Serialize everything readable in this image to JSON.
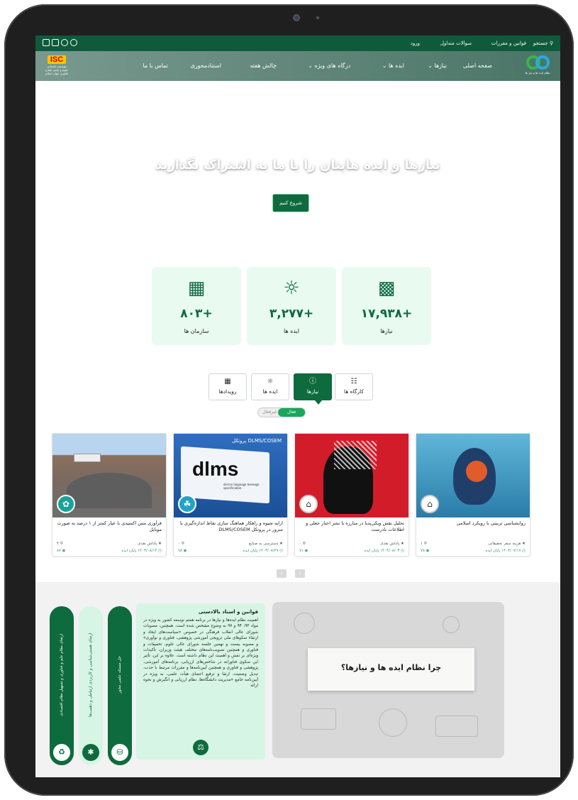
{
  "topbar": {
    "search": "جستجو",
    "rules": "قوانین و مقررات",
    "faq": "سوالات متداول",
    "login": "ورود"
  },
  "logo": {
    "caption": "نظام ایده ها و نیاز ها"
  },
  "isc": {
    "mark": "ISC",
    "caption": "مؤسسه استنادی علوم و پایش علم و فناوری جهان اسلام"
  },
  "nav": {
    "items": [
      "صفحه اصلی",
      "نیازها",
      "ایده ها",
      "درگاه های ویژه",
      "چالش هفته",
      "استنادمحوری",
      "تماس با ما"
    ]
  },
  "hero": {
    "title": "نیازها و ایده هایتان را با ما به اشتراک بگذارید",
    "cta": "شروع کنیم"
  },
  "stats": [
    {
      "value": "+۱۷,۹۳۸",
      "label": "نیازها",
      "icon": "puzzle-icon"
    },
    {
      "value": "+۳,۲۷۷",
      "label": "ایده ها",
      "icon": "lightbulb-icon"
    },
    {
      "value": "+۸۰۳",
      "label": "سازمان ها",
      "icon": "building-icon"
    }
  ],
  "tabs": [
    {
      "label": "کارگاه ها",
      "icon": "workshop-icon"
    },
    {
      "label": "نیازها",
      "icon": "question-icon"
    },
    {
      "label": "ایده ها",
      "icon": "bulb-icon"
    },
    {
      "label": "رویدادها",
      "icon": "calendar-icon"
    }
  ],
  "toggle": {
    "on": "فعال",
    "off": "غیرفعال"
  },
  "cards": [
    {
      "title": "روانشناسی تربیتی با رویکرد اسلامی",
      "reward": "هزینه سفر تحقیقاتی",
      "deadline": "۱۴۰۳/۰۷/۱۷ پایان ایده",
      "count1": "۱",
      "count2": "۷۸"
    },
    {
      "title": "تحلیل نقش ویکی‌پدیا در مبارزه با نشر اخبار جعلی و اطلاعات نادرست",
      "reward": "پاداش نقدی",
      "deadline": "۱۴۰۳/۰۸/۰۳ پایان ایده",
      "count1": "۰",
      "count2": "۷۱"
    },
    {
      "title": "ارایه شیوه و راهکار هماهنگ سازی نقاط اندازه‌گیری با سرور در پروتکل DLMS/COSEM",
      "reward": "دسترسی به صنایع",
      "deadline": "۱۴۰۳/۰۷/۲۹ پایان ایده",
      "count1": "۰",
      "count2": "۹۸",
      "image_banner": "پروتکل DLMS/COSEM",
      "image_word": "dlms",
      "image_sub": "device language message specification"
    },
    {
      "title": "فرآوری مس اکسیدی با عیار کمتر از ۱ درصد به صورت موبایل",
      "reward": "پاداش نقدی",
      "deadline": "۱۴۰۳/۰۸/۱۴ پایان ایده",
      "count1": "۴",
      "count2": "۸۷"
    }
  ],
  "why": {
    "title": "چرا نظام ایده ها و نیازها؟"
  },
  "laws": {
    "title": "قوانین و اسناد بالادستی",
    "body": "اهمیت نظام ایده‌ها و نیازها در برنامه هفتم توسعه کشور به ویژه در مواد ۹۳، ۹۴ و ۹۷ به وضوح مشخص شده است. همچنین، مصوبات شورای عالی انقلاب فرهنگی در خصوص «سیاست‌های ایجاد و ارتقاء سکوهای ملی ترویجی آموزشی پژوهشی، فناوری و نوآوری» و مصوبه بیست و نهمین جلسه شورای عالی علوم، تحقیقات و فناوری و همچنین تصویب‌نامه‌های مختلف هیئت وزیران، تأکیدات ویژه‌ای بر نقش و اهمیت این نظام داشته است. علاوه بر این، تأثیر این سکوی فناورانه در شاخص‌های ارزیابی، برنامه‌های آموزشی، پژوهشی و فناوری و همچنین آیین‌نامه‌ها و مقررات مرتبط با جذب، تبدیل وضعیت، ارتقا و ترفیع اعضای هیأت علمی، به ویژه در آیین‌نامه جامع «مدیریت دانشگاه‌ها، نظام ارزیابی و انگیزش و نحوه ارائه"
  },
  "pills": [
    {
      "label": "حل مسئله علمی محور",
      "icon": "coins-icon"
    },
    {
      "label": "ارتقای هستی‌شناسی و کاربردی ارتباطی و ذهنیت‌ها",
      "icon": "network-icon"
    },
    {
      "label": "ارتقای نظام علم و فناوری و تسهیل نظام اقتصادی",
      "icon": "recycle-icon"
    }
  ],
  "colors": {
    "brand": "#0d6b3d",
    "topbar": "#0f5a3c",
    "stat_bg": "#e9faf1"
  }
}
